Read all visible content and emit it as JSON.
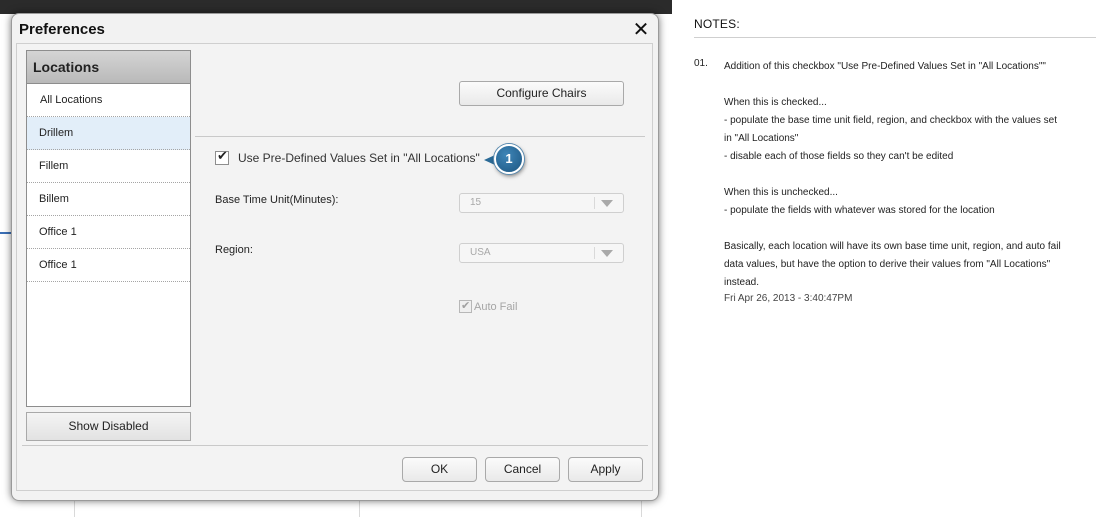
{
  "dialog": {
    "title": "Preferences",
    "close_glyph": "✕",
    "locations_header": "Locations",
    "locations": [
      "All Locations",
      "Drillem",
      "Fillem",
      "Billem",
      "Office 1",
      "Office 1"
    ],
    "selected_location": "Drillem",
    "show_disabled_label": "Show Disabled",
    "configure_chairs_label": "Configure Chairs",
    "predefined_checkbox": {
      "label": "Use Pre-Defined Values Set in \"All Locations\"",
      "checked": true
    },
    "callout_number": "1",
    "base_time_unit": {
      "label": "Base Time Unit(Minutes):",
      "value": "15"
    },
    "region": {
      "label": "Region:",
      "value": "USA"
    },
    "auto_fail": {
      "label": "Auto Fail",
      "checked": true,
      "disabled": true
    },
    "buttons": {
      "ok": "OK",
      "cancel": "Cancel",
      "apply": "Apply"
    }
  },
  "notes": {
    "title": "NOTES:",
    "number": "01.",
    "lines": [
      "Addition of this checkbox \"Use Pre-Defined Values Set in \"All Locations\"\"",
      "",
      "When this is checked...",
      "- populate the base time unit field, region, and checkbox with the values set",
      "in \"All Locations\"",
      "- disable each of those fields so they can't be edited",
      "",
      "When this is unchecked...",
      "- populate the fields with whatever was stored for the location",
      "",
      "Basically, each location will have its own base time unit, region, and auto fail",
      "data values, but have the option to derive their values from \"All Locations\"",
      "instead."
    ],
    "timestamp": "Fri Apr 26, 2013 - 3:40:47PM"
  },
  "colors": {
    "selected_row": "#e2eef9",
    "callout": "#1c5580",
    "disabled_text": "#a8a8a8"
  },
  "icons": [
    "close-icon",
    "checkmark-icon",
    "dropdown-arrow-icon",
    "callout-marker-icon"
  ]
}
